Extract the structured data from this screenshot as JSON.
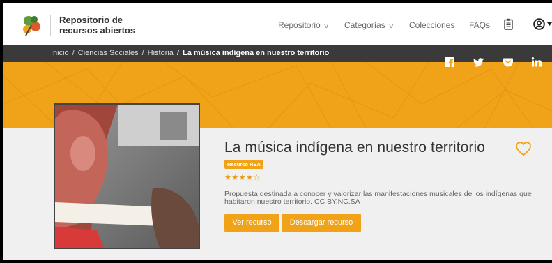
{
  "header": {
    "brand_line1": "Repositorio de",
    "brand_line2": "recursos abiertos",
    "nav": [
      {
        "label": "Repositorio"
      },
      {
        "label": "Categorías"
      },
      {
        "label": "Colecciones"
      },
      {
        "label": "FAQs"
      }
    ],
    "icons": [
      "clipboard-icon",
      "user-icon",
      "chevron-down-icon"
    ]
  },
  "breadcrumb": {
    "items": [
      "Inicio",
      "Ciencias Sociales",
      "Historia"
    ],
    "current": "La música indígena en nuestro territorio"
  },
  "social": [
    "facebook-icon",
    "twitter-icon",
    "pocket-icon",
    "linkedin-icon"
  ],
  "resource": {
    "title": "La música indígena en nuestro territorio",
    "badge": "Recurso REA",
    "rating": 4,
    "rating_max": 5,
    "stars_text": "★★★★☆",
    "description": "Propuesta destinada a conocer y valorizar las manifestaciones musicales de los indígenas que habitaron nuestro territorio. CC BY.NC.SA",
    "view_button": "Ver recurso",
    "download_button": "Descargar recurso"
  },
  "colors": {
    "accent": "#f0a318",
    "breadcrumb_bg": "#3a3a3a"
  }
}
